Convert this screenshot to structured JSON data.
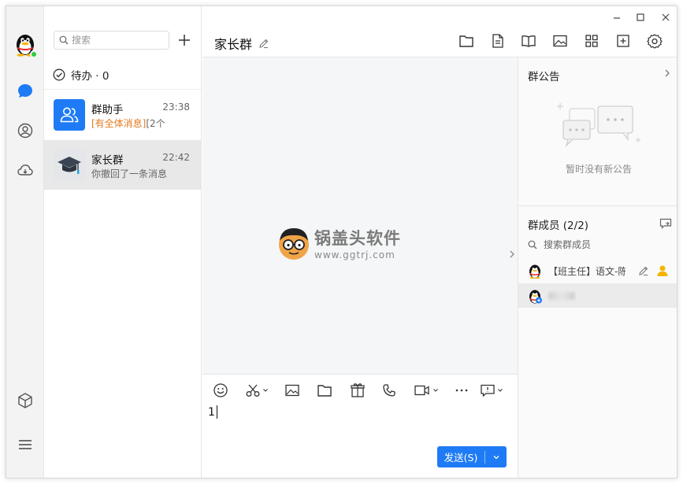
{
  "window": {
    "controls": [
      "minimize",
      "maximize",
      "close"
    ]
  },
  "nav": {
    "items": [
      {
        "name": "messages",
        "icon": "chat-bubble-icon",
        "active": true
      },
      {
        "name": "contacts",
        "icon": "contact-icon"
      },
      {
        "name": "cloud",
        "icon": "cloud-icon"
      },
      {
        "name": "app-center",
        "icon": "cube-icon"
      },
      {
        "name": "menu",
        "icon": "hamburger-icon"
      }
    ]
  },
  "sessions": {
    "search_placeholder": "搜索",
    "todo_label": "待办 · 0",
    "items": [
      {
        "name": "群助手",
        "time": "23:38",
        "preview_mention": "[有全体消息]",
        "preview_rest": "[2个",
        "avatar_color": "#1e7bf5"
      },
      {
        "name": "家长群",
        "time": "22:42",
        "preview_mention": "",
        "preview_rest": "你撤回了一条消息",
        "avatar_color": "#e4e6ea"
      }
    ]
  },
  "chat": {
    "title": "家长群",
    "watermark_title": "锅盖头软件",
    "watermark_url": "www.ggtrj.com",
    "compose_text": "1",
    "send_label": "发送(S)"
  },
  "right_panel": {
    "notice_title": "群公告",
    "notice_empty": "暂时没有新公告",
    "members_title": "群成员 (2/2)",
    "member_search_placeholder": "搜索群成员",
    "members": [
      {
        "name": "【班主任】语文-陈",
        "role": "owner"
      },
      {
        "name": "",
        "role": "admin"
      }
    ]
  },
  "colors": {
    "accent": "#1e7bf5",
    "mention": "#e07a1f",
    "owner_badge": "#f5b400"
  }
}
